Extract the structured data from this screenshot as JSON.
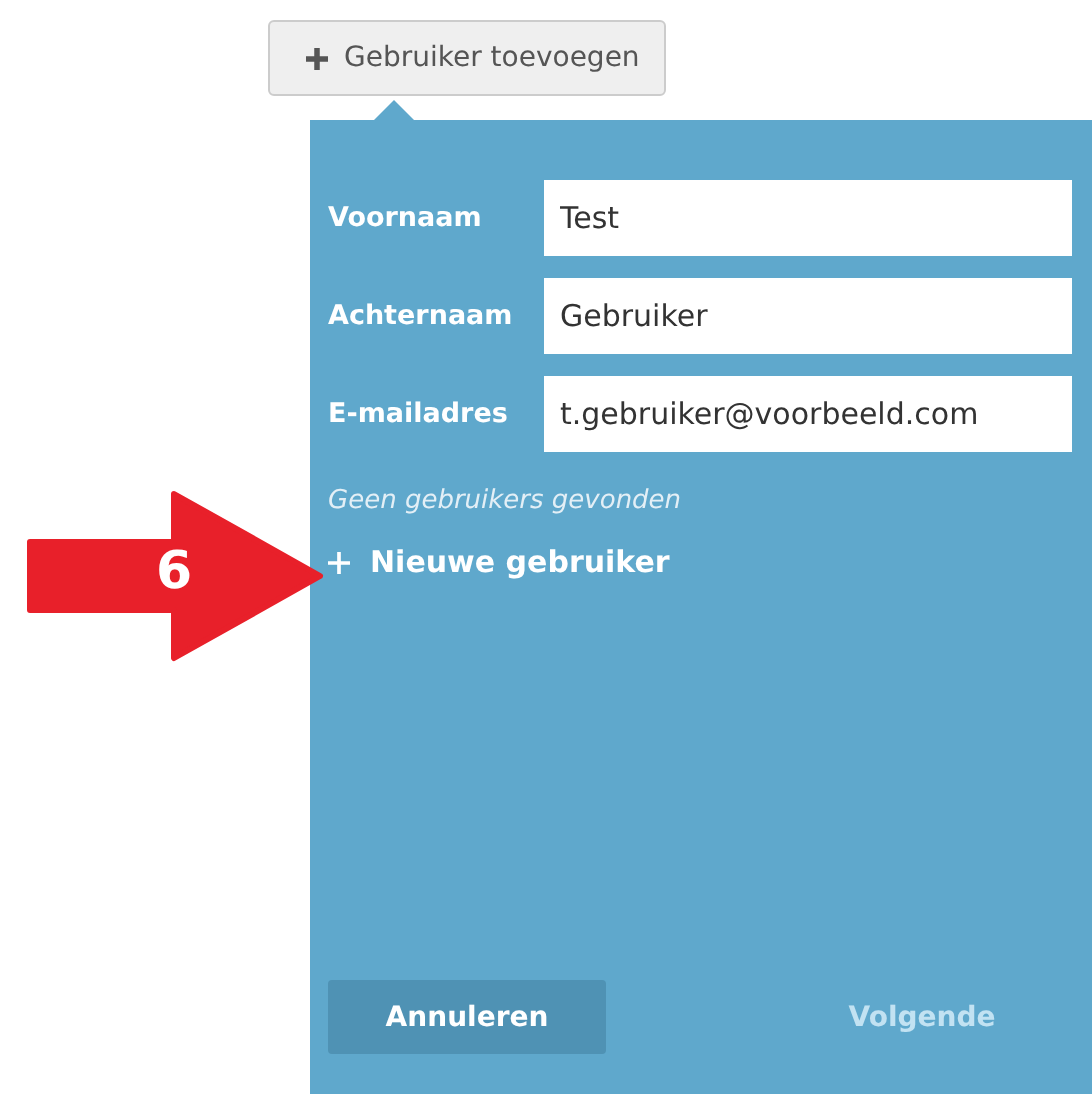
{
  "add_user_button": {
    "label": "Gebruiker toevoegen"
  },
  "form": {
    "fields": [
      {
        "label": "Voornaam",
        "value": "Test"
      },
      {
        "label": "Achternaam",
        "value": "Gebruiker"
      },
      {
        "label": "E-mailadres",
        "value": "t.gebruiker@voorbeeld.com"
      }
    ],
    "no_results": "Geen gebruikers gevonden",
    "new_user_link": "Nieuwe gebruiker",
    "buttons": [
      {
        "label": "Annuleren",
        "disabled": false
      },
      {
        "label": "Volgende",
        "disabled": true
      }
    ]
  },
  "callout": {
    "label": "6"
  }
}
